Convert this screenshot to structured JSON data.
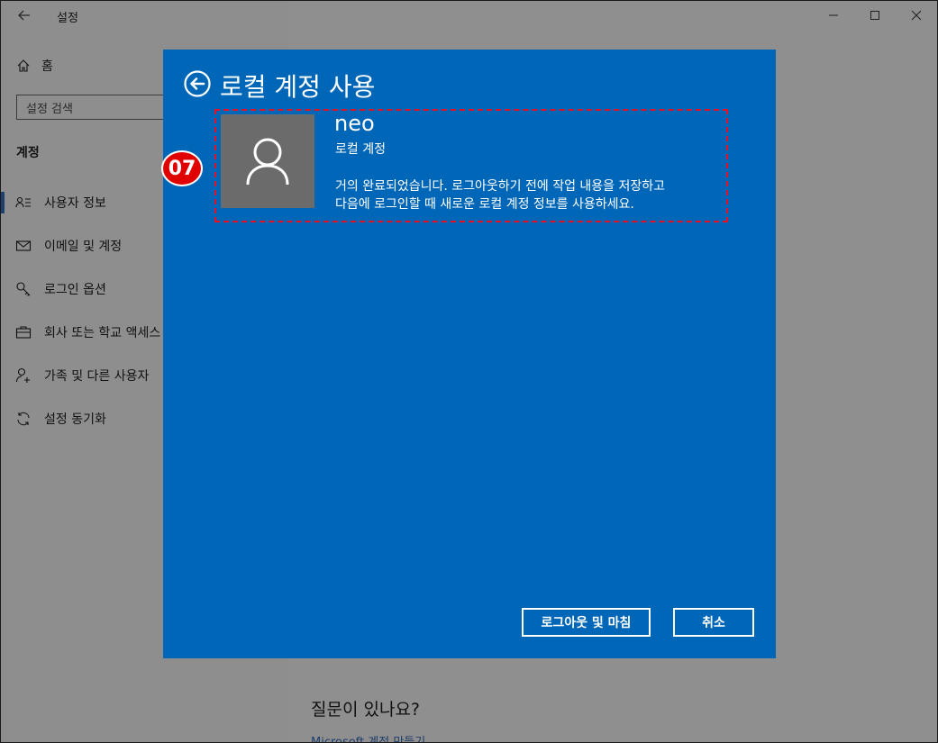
{
  "window": {
    "app_title": "설정",
    "controls": [
      "minimize-icon",
      "maximize-icon",
      "close-icon"
    ]
  },
  "sidebar": {
    "home_label": "홈",
    "search_placeholder": "설정 검색",
    "section_title": "계정",
    "items": [
      {
        "label": "사용자 정보",
        "icon": "person-list-icon",
        "active": true
      },
      {
        "label": "이메일 및 계정",
        "icon": "mail-icon"
      },
      {
        "label": "로그인 옵션",
        "icon": "key-icon"
      },
      {
        "label": "회사 또는 학교 액세스",
        "icon": "briefcase-icon"
      },
      {
        "label": "가족 및 다른 사용자",
        "icon": "person-add-icon"
      },
      {
        "label": "설정 동기화",
        "icon": "sync-icon"
      }
    ]
  },
  "content": {
    "question": "질문이 있나요?",
    "help_link": "Microsoft 계정 만들기"
  },
  "dialog": {
    "title": "로컬 계정 사용",
    "step_badge": "07",
    "account_name": "neo",
    "account_type": "로컬 계정",
    "message_line1": "거의 완료되었습니다. 로그아웃하기 전에 작업 내용을 저장하고",
    "message_line2": "다음에 로그인할 때 새로운 로컬 계정 정보를 사용하세요.",
    "signout_button": "로그아웃 및 마침",
    "cancel_button": "취소",
    "colors": {
      "background": "#0067b8",
      "highlight": "#e81123",
      "badge": "#e10000"
    }
  }
}
